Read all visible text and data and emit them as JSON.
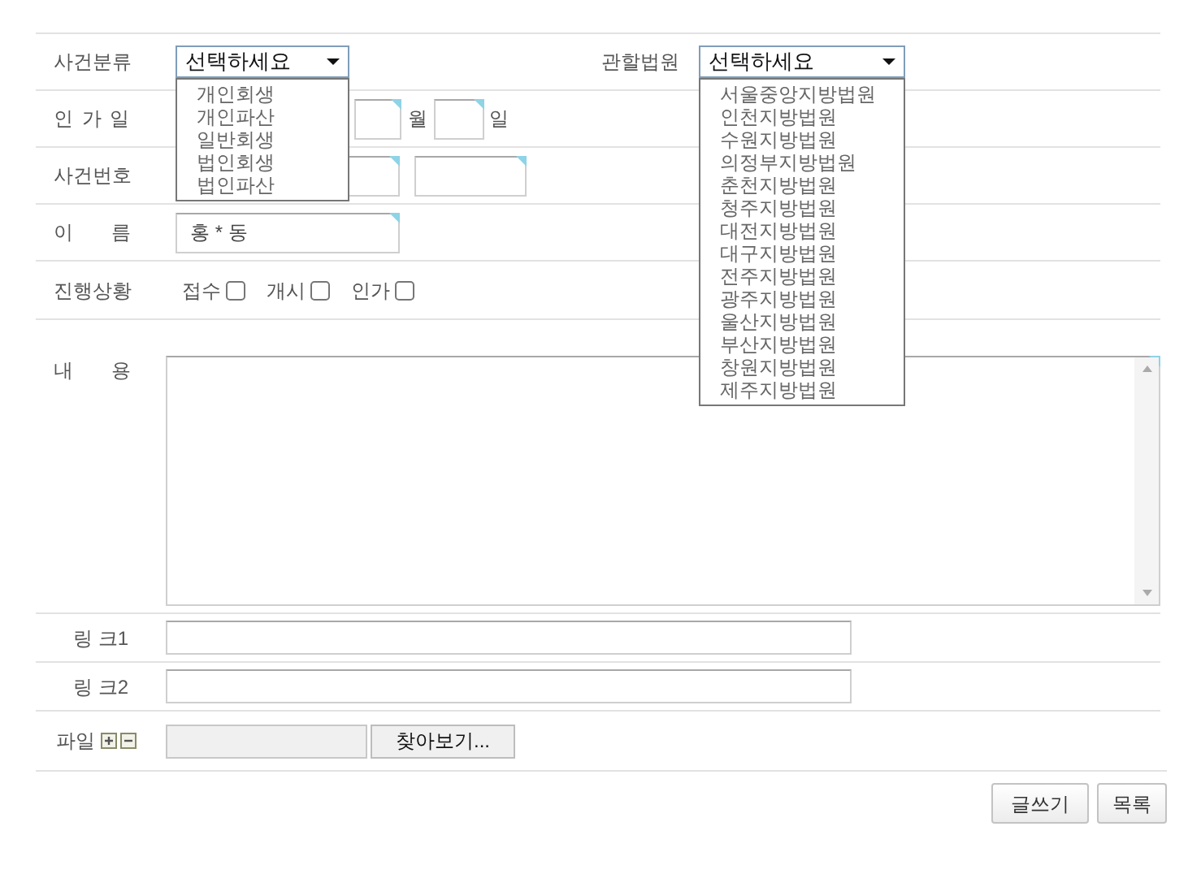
{
  "case_type": {
    "label": "사건분류",
    "select": {
      "value": "선택하세요",
      "expanded": true,
      "options": [
        "개인회생",
        "개인파산",
        "일반회생",
        "법인회생",
        "법인파산"
      ]
    }
  },
  "court": {
    "label": "관할법원",
    "select": {
      "value": "선택하세요",
      "expanded": true,
      "options": [
        "서울중앙지방법원",
        "인천지방법원",
        "수원지방법원",
        "의정부지방법원",
        "춘천지방법원",
        "청주지방법원",
        "대전지방법원",
        "대구지방법원",
        "전주지방법원",
        "광주지방법원",
        "울산지방법원",
        "부산지방법원",
        "창원지방법원",
        "제주지방법원"
      ]
    }
  },
  "approval_date": {
    "label": "인 가 일",
    "units": [
      "월",
      "일"
    ]
  },
  "case_number": {
    "label": "사건번호"
  },
  "name": {
    "label": "이 름",
    "value": "홍 * 동"
  },
  "progress": {
    "label": "진행상황",
    "options": [
      {
        "label": "접수",
        "checked": false
      },
      {
        "label": "개시",
        "checked": false
      },
      {
        "label": "인가",
        "checked": false
      }
    ]
  },
  "content": {
    "label": "내 용"
  },
  "links": [
    {
      "label": "링 크1"
    },
    {
      "label": "링 크2"
    }
  ],
  "file": {
    "label": "파일",
    "browse_button": "찾아보기..."
  },
  "buttons": [
    "글쓰기",
    "목록"
  ]
}
